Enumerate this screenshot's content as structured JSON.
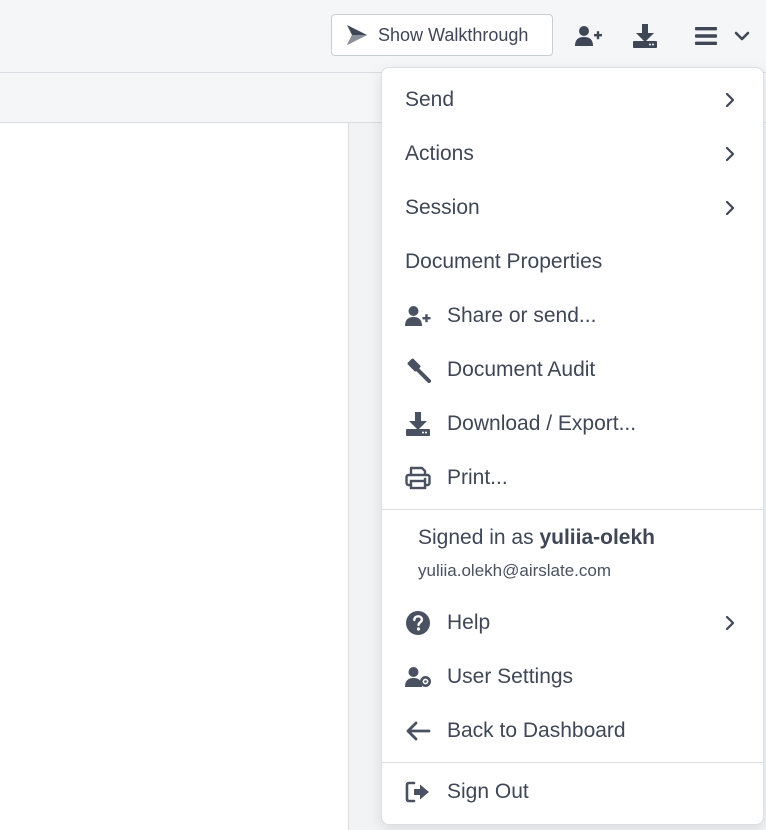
{
  "header": {
    "walkthrough_label": "Show Walkthrough",
    "icons": [
      "walkthrough-icon",
      "add-user-icon",
      "download-icon",
      "hamburger-menu-icon",
      "chevron-down-icon"
    ]
  },
  "menu": {
    "items_top": [
      {
        "label": "Send",
        "submenu": true
      },
      {
        "label": "Actions",
        "submenu": true
      },
      {
        "label": "Session",
        "submenu": true
      },
      {
        "label": "Document Properties",
        "submenu": false
      },
      {
        "label": "Share or send...",
        "icon": "share-user-icon"
      },
      {
        "label": "Document Audit",
        "icon": "gavel-icon"
      },
      {
        "label": "Download / Export...",
        "icon": "download-icon"
      },
      {
        "label": "Print...",
        "icon": "printer-icon"
      }
    ],
    "account": {
      "signed_in_prefix": "Signed in as",
      "username": "yuliia-olekh",
      "email": "yuliia.olekh@airslate.com"
    },
    "items_account": [
      {
        "label": "Help",
        "icon": "help-circle-icon",
        "submenu": true
      },
      {
        "label": "User Settings",
        "icon": "user-settings-icon"
      },
      {
        "label": "Back to Dashboard",
        "icon": "arrow-left-icon"
      }
    ],
    "sign_out": {
      "label": "Sign Out",
      "icon": "sign-out-icon"
    }
  },
  "colors": {
    "text": "#3f4756",
    "header_bg": "#f5f6f7",
    "border": "#dcdfe4",
    "icon": "#4a5261"
  }
}
